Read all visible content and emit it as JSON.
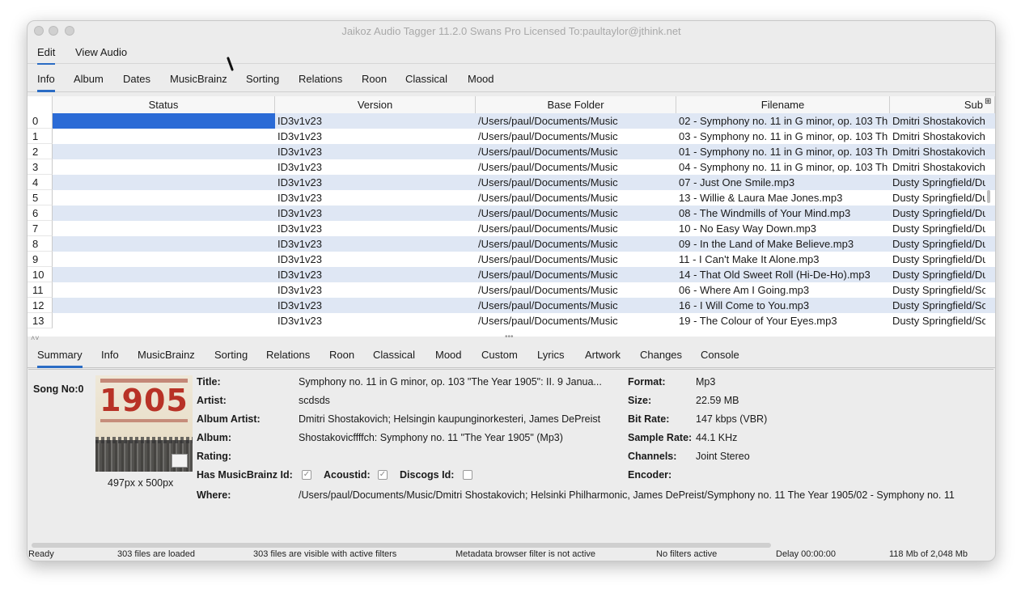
{
  "window": {
    "title": "Jaikoz Audio Tagger 11.2.0 Swans Pro Licensed To:paultaylor@jthink.net"
  },
  "menubar": [
    "Edit",
    "View Audio"
  ],
  "top_tabs": [
    "Info",
    "Album",
    "Dates",
    "MusicBrainz",
    "Sorting",
    "Relations",
    "Roon",
    "Classical",
    "Mood"
  ],
  "table": {
    "columns": [
      "Status",
      "Version",
      "Base Folder",
      "Filename",
      "Sub"
    ],
    "rows": [
      {
        "n": "0",
        "version": "ID3v1v23",
        "folder": "/Users/paul/Documents/Music",
        "filename": "02 - Symphony no. 11 in G minor, op. 103 Th",
        "sub": "Dmitri Shostakovich"
      },
      {
        "n": "1",
        "version": "ID3v1v23",
        "folder": "/Users/paul/Documents/Music",
        "filename": "03 - Symphony no. 11 in G minor, op. 103 Th",
        "sub": "Dmitri Shostakovich"
      },
      {
        "n": "2",
        "version": "ID3v1v23",
        "folder": "/Users/paul/Documents/Music",
        "filename": "01 - Symphony no. 11 in G minor, op. 103 Th",
        "sub": "Dmitri Shostakovich"
      },
      {
        "n": "3",
        "version": "ID3v1v23",
        "folder": "/Users/paul/Documents/Music",
        "filename": "04 - Symphony no. 11 in G minor, op. 103 Th",
        "sub": "Dmitri Shostakovich"
      },
      {
        "n": "4",
        "version": "ID3v1v23",
        "folder": "/Users/paul/Documents/Music",
        "filename": "07 - Just One Smile.mp3",
        "sub": "Dusty Springfield/Du"
      },
      {
        "n": "5",
        "version": "ID3v1v23",
        "folder": "/Users/paul/Documents/Music",
        "filename": "13 - Willie & Laura Mae Jones.mp3",
        "sub": "Dusty Springfield/Du"
      },
      {
        "n": "6",
        "version": "ID3v1v23",
        "folder": "/Users/paul/Documents/Music",
        "filename": "08 - The Windmills of Your Mind.mp3",
        "sub": "Dusty Springfield/Du"
      },
      {
        "n": "7",
        "version": "ID3v1v23",
        "folder": "/Users/paul/Documents/Music",
        "filename": "10 - No Easy Way Down.mp3",
        "sub": "Dusty Springfield/Du"
      },
      {
        "n": "8",
        "version": "ID3v1v23",
        "folder": "/Users/paul/Documents/Music",
        "filename": "09 - In the Land of Make Believe.mp3",
        "sub": "Dusty Springfield/Du"
      },
      {
        "n": "9",
        "version": "ID3v1v23",
        "folder": "/Users/paul/Documents/Music",
        "filename": "11 - I Can't Make It Alone.mp3",
        "sub": "Dusty Springfield/Du"
      },
      {
        "n": "10",
        "version": "ID3v1v23",
        "folder": "/Users/paul/Documents/Music",
        "filename": "14 - That Old Sweet Roll (Hi-De-Ho).mp3",
        "sub": "Dusty Springfield/Du"
      },
      {
        "n": "11",
        "version": "ID3v1v23",
        "folder": "/Users/paul/Documents/Music",
        "filename": "06 - Where Am I Going.mp3",
        "sub": "Dusty Springfield/Sc"
      },
      {
        "n": "12",
        "version": "ID3v1v23",
        "folder": "/Users/paul/Documents/Music",
        "filename": "16 - I Will Come to You.mp3",
        "sub": "Dusty Springfield/Sc"
      },
      {
        "n": "13",
        "version": "ID3v1v23",
        "folder": "/Users/paul/Documents/Music",
        "filename": "19 - The Colour of Your Eyes.mp3",
        "sub": "Dusty Springfield/Sc"
      }
    ]
  },
  "bottom_tabs": [
    "Summary",
    "Info",
    "MusicBrainz",
    "Sorting",
    "Relations",
    "Roon",
    "Classical",
    "Mood",
    "Custom",
    "Lyrics",
    "Artwork",
    "Changes",
    "Console"
  ],
  "summary": {
    "song_no": "Song No:0",
    "artwork_size": "497px x 500px",
    "artwork_text": "1905",
    "labels": {
      "title": "Title:",
      "artist": "Artist:",
      "album_artist": "Album Artist:",
      "album": "Album:",
      "rating": "Rating:",
      "has_mb": "Has MusicBrainz Id:",
      "acoustid": "Acoustid:",
      "discogs": "Discogs Id:",
      "where": "Where:",
      "format": "Format:",
      "size": "Size:",
      "bitrate": "Bit Rate:",
      "samplerate": "Sample Rate:",
      "channels": "Channels:",
      "encoder": "Encoder:"
    },
    "values": {
      "title": "Symphony no. 11 in G minor, op. 103 \"The Year 1905\": II. 9 Janua...",
      "artist": "scdsds",
      "album_artist": "Dmitri Shostakovich; Helsingin kaupunginorkesteri, James DePreist",
      "album": "Shostakovicffffch: Symphony no. 11 \"The Year 1905\"  (Mp3)",
      "rating": "",
      "where": "/Users/paul/Documents/Music/Dmitri Shostakovich; Helsinki Philharmonic, James DePreist/Symphony no. 11 The Year 1905/02 - Symphony no. 11",
      "format": "Mp3",
      "size": "22.59 MB",
      "bitrate": "147 kbps (VBR)",
      "samplerate": "44.1 KHz",
      "channels": "Joint Stereo",
      "encoder": ""
    },
    "checks": {
      "has_mb": true,
      "acoustid": true,
      "discogs": false
    }
  },
  "statusbar": [
    "Ready",
    "303 files are loaded",
    "303 files are visible with active filters",
    "Metadata browser filter is not active",
    "No filters active",
    "Delay 00:00:00",
    "118 Mb of 2,048 Mb"
  ],
  "colors": {
    "accent": "#2b6cc4",
    "selection": "#2b6bd6",
    "row_alt": "#dfe7f4"
  }
}
